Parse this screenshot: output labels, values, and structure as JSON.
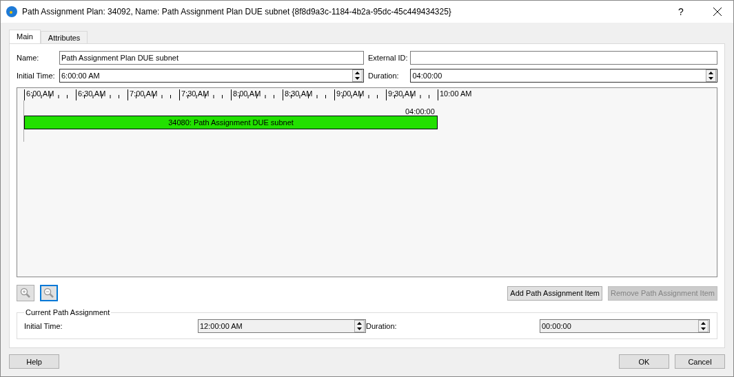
{
  "window": {
    "title": "Path Assignment Plan: 34092, Name: Path Assignment Plan DUE subnet  {8f8d9a3c-1184-4b2a-95dc-45c449434325}",
    "help": "?"
  },
  "tabs": [
    {
      "label": "Main",
      "selected": true
    },
    {
      "label": "Attributes",
      "selected": false
    }
  ],
  "fields": [
    {
      "label": "Name:",
      "value": "Path Assignment Plan DUE subnet",
      "kind": "text"
    },
    {
      "label": "External ID:",
      "kind": "text"
    },
    {
      "label": "Initial Time:",
      "value": "6:00:00 AM",
      "kind": "spin"
    },
    {
      "label": "Duration:",
      "value": "04:00:00",
      "kind": "spin"
    }
  ],
  "timeline": {
    "ticks": [
      "6:00 AM",
      "6:30 AM",
      "7:00 AM",
      "7:30 AM",
      "8:00 AM",
      "8:30 AM",
      "9:00 AM",
      "9:30 AM",
      "10:00 AM"
    ],
    "items": [
      {
        "label": "34080: Path Assignment DUE subnet",
        "duration": "04:00:00",
        "color": "#22e000"
      }
    ]
  },
  "zoom_buttons": [
    {
      "kind": "zoom-in",
      "focused": false
    },
    {
      "kind": "zoom-out",
      "focused": true
    }
  ],
  "item_buttons": [
    {
      "label": "Add Path Assignment Item",
      "disabled": false
    },
    {
      "label": "Remove Path Assignment Item",
      "disabled": true
    }
  ],
  "current": {
    "title": "Current Path Assignment",
    "fields": [
      {
        "label": "Initial Time:",
        "value": "12:00:00 AM",
        "disabled": true
      },
      {
        "label": "Duration:",
        "value": "00:00:00",
        "disabled": true
      }
    ]
  },
  "footer": {
    "left": [
      {
        "label": "Help"
      }
    ],
    "right": [
      {
        "label": "OK"
      },
      {
        "label": "Cancel"
      }
    ]
  }
}
